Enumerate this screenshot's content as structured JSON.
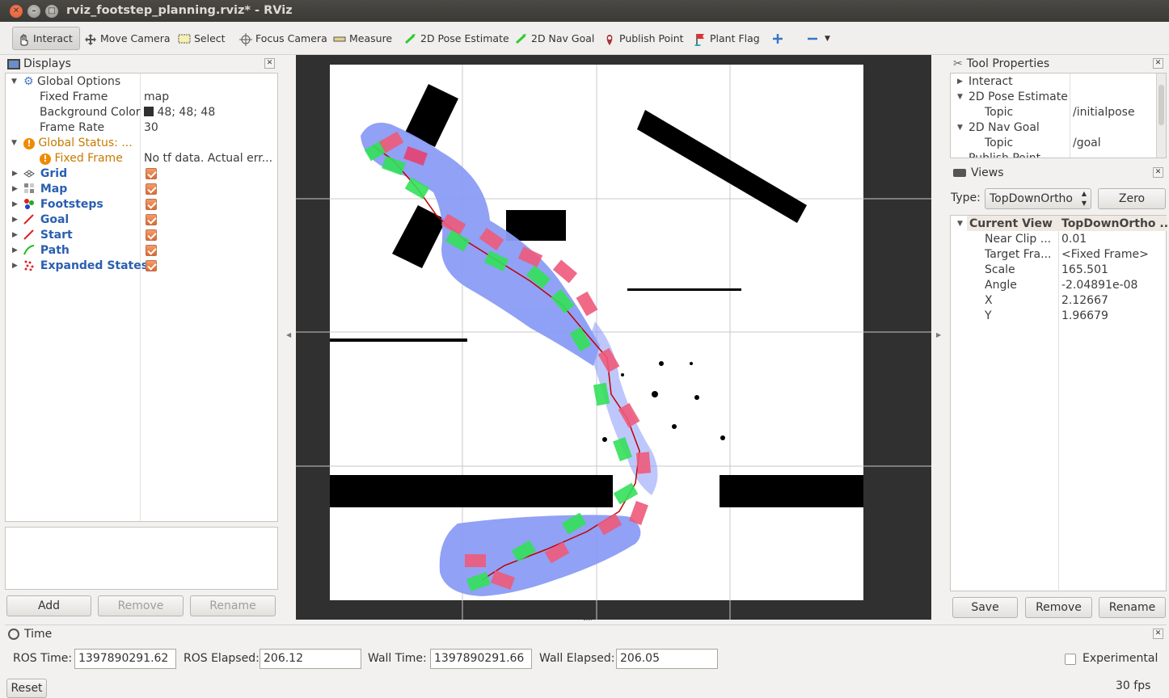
{
  "window": {
    "title": "rviz_footstep_planning.rviz* - RViz"
  },
  "toolbar": {
    "interact": "Interact",
    "move_camera": "Move Camera",
    "select": "Select",
    "focus_camera": "Focus Camera",
    "measure": "Measure",
    "pose_estimate": "2D Pose Estimate",
    "nav_goal": "2D Nav Goal",
    "publish_point": "Publish Point",
    "plant_flag": "Plant Flag"
  },
  "displays": {
    "title": "Displays",
    "global_options": "Global Options",
    "fixed_frame_label": "Fixed Frame",
    "fixed_frame_value": "map",
    "background_label": "Background Color",
    "background_value": "48; 48; 48",
    "background_color": "#303030",
    "frame_rate_label": "Frame Rate",
    "frame_rate_value": "30",
    "global_status": "Global Status: ...",
    "status_fixed_frame": "Fixed Frame",
    "status_message": "No tf data.  Actual err...",
    "items": [
      {
        "label": "Grid",
        "enabled": true
      },
      {
        "label": "Map",
        "enabled": true
      },
      {
        "label": "Footsteps",
        "enabled": true
      },
      {
        "label": "Goal",
        "enabled": true
      },
      {
        "label": "Start",
        "enabled": true
      },
      {
        "label": "Path",
        "enabled": true
      },
      {
        "label": "Expanded States",
        "enabled": true
      }
    ],
    "add": "Add",
    "remove": "Remove",
    "rename": "Rename"
  },
  "tool_properties": {
    "title": "Tool Properties",
    "rows": [
      {
        "label": "Interact",
        "value": ""
      },
      {
        "label": "2D Pose Estimate",
        "value": ""
      },
      {
        "label": "Topic",
        "value": "/initialpose"
      },
      {
        "label": "2D Nav Goal",
        "value": ""
      },
      {
        "label": "Topic",
        "value": "/goal"
      },
      {
        "label": "Publish Point",
        "value": ""
      }
    ]
  },
  "views": {
    "title": "Views",
    "type_label": "Type:",
    "type_value": "TopDownOrtho",
    "zero": "Zero",
    "current_view": "Current View",
    "current_type": "TopDownOrtho ...",
    "props": [
      {
        "label": "Near Clip ...",
        "value": "0.01"
      },
      {
        "label": "Target Fra...",
        "value": "<Fixed Frame>"
      },
      {
        "label": "Scale",
        "value": "165.501"
      },
      {
        "label": "Angle",
        "value": "-2.04891e-08"
      },
      {
        "label": "X",
        "value": "2.12667"
      },
      {
        "label": "Y",
        "value": "1.96679"
      }
    ],
    "save": "Save",
    "remove": "Remove",
    "rename": "Rename"
  },
  "time": {
    "title": "Time",
    "ros_time_label": "ROS Time:",
    "ros_time": "1397890291.62",
    "ros_elapsed_label": "ROS Elapsed:",
    "ros_elapsed": "206.12",
    "wall_time_label": "Wall Time:",
    "wall_time": "1397890291.66",
    "wall_elapsed_label": "Wall Elapsed:",
    "wall_elapsed": "206.05",
    "experimental": "Experimental",
    "reset": "Reset",
    "fps": "30 fps"
  }
}
